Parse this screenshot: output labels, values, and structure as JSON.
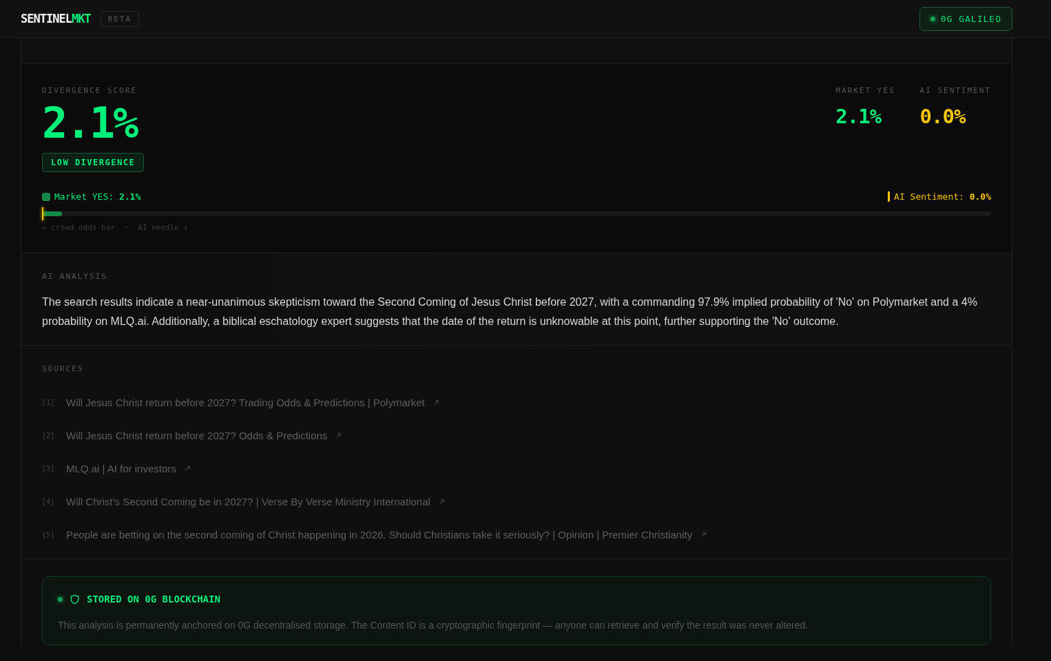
{
  "header": {
    "logo_main": "SENTINEL",
    "logo_accent": "MKT",
    "badge": "BETA",
    "network": "0G GALILEO"
  },
  "divergence": {
    "label": "DIVERGENCE SCORE",
    "score": "2.1%",
    "tag": "LOW DIVERGENCE",
    "stats": [
      {
        "label": "MARKET YES",
        "value": "2.1%",
        "kind": "market"
      },
      {
        "label": "AI SENTIMENT",
        "value": "0.0%",
        "kind": "ai"
      }
    ],
    "market_legend": "Market YES:",
    "market_value": "2.1%",
    "ai_legend": "AI Sentiment:",
    "ai_value": "0.0%",
    "market_bar": {
      "level": 0.021
    },
    "ai_needle": {
      "level": 0.0
    },
    "hint": "← crowd odds bar  ·  AI needle ↕"
  },
  "analysis": {
    "label": "AI ANALYSIS",
    "text": "The search results indicate a near-unanimous skepticism toward the Second Coming of Jesus Christ before 2027, with a commanding 97.9% implied probability of 'No' on Polymarket and a 4% probability on MLQ.ai. Additionally, a biblical eschatology expert suggests that the date of the return is unknowable at this point, further supporting the 'No' outcome."
  },
  "sources": {
    "label": "SOURCES",
    "items": [
      {
        "index": "[1]",
        "title": "Will Jesus Christ return before 2027? Trading Odds & Predictions | Polymarket"
      },
      {
        "index": "[2]",
        "title": "Will Jesus Christ return before 2027? Odds & Predictions"
      },
      {
        "index": "[3]",
        "title": "MLQ.ai | AI for investors"
      },
      {
        "index": "[4]",
        "title": "Will Christ’s Second Coming be in 2027? | Verse By Verse Ministry International"
      },
      {
        "index": "[5]",
        "title": "People are betting on the second coming of Christ happening in 2026. Should Christians take it seriously? | Opinion | Premier Christianity"
      }
    ]
  },
  "storage": {
    "title": "STORED ON 0G BLOCKCHAIN",
    "text": "This analysis is permanently anchored on 0G decentralised storage. The Content ID is a cryptographic fingerprint — anyone can retrieve and verify the result was never altered."
  }
}
